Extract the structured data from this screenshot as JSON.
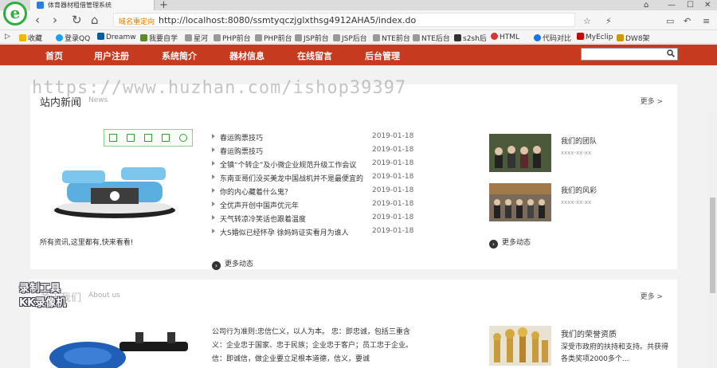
{
  "browser": {
    "tab_title": "体育器材租借管理系统",
    "address_tag": "域名重定向",
    "url": "http://localhost:8080/ssmtyqczjglxthsg4912AHA5/index.do",
    "bookmarks": [
      "收藏",
      "登录QQ",
      "Dreamw",
      "我要自学",
      "星河",
      "PHP前台",
      "PHP前台",
      "JSP前台",
      "JSP后台",
      "NTE前台",
      "NTE后台",
      "s2sh后",
      "HTML",
      "代码对比",
      "MyEclip",
      "DW8架"
    ]
  },
  "nav": {
    "items": [
      "首页",
      "用户注册",
      "系统简介",
      "器材信息",
      "在线留言",
      "后台管理"
    ],
    "search_placeholder": ""
  },
  "watermark": "https://www.huzhan.com/ishop39397",
  "news": {
    "title": "站内新闻",
    "subtitle": "News",
    "more": "更多 >",
    "caption": "所有资讯,这里都有,快来看看!",
    "items": [
      {
        "text": "春运购票技巧",
        "date": "2019-01-18"
      },
      {
        "text": "春运购票技巧",
        "date": "2019-01-18"
      },
      {
        "text": "全镇“个转企”及小微企业规范升级工作会议",
        "date": "2019-01-18"
      },
      {
        "text": "东南亚哥们没买美龙中国战机并不是最便宜的",
        "date": "2019-01-18"
      },
      {
        "text": "你的内心藏着什么鬼？",
        "date": "2019-01-18"
      },
      {
        "text": "全优声开创中国声优元年",
        "date": "2019-01-18"
      },
      {
        "text": "天气转凉冷笑话也跟着温度",
        "date": "2019-01-18"
      },
      {
        "text": "大S婚似已经怀孕 徐妈妈证实看月为谁人",
        "date": "2019-01-18"
      }
    ],
    "more_link": "更多动态",
    "side": [
      {
        "label": "我们的团队",
        "meta": "xxxx-xx-xx"
      },
      {
        "label": "我们的风彩",
        "meta": "xxxx-xx-xx"
      }
    ],
    "side_more": "更多动态"
  },
  "about": {
    "title": "关于我们",
    "subtitle": "About us",
    "more": "更多 >",
    "text": "公司行为准则:忠信仁义，以人为本。 忠：即忠诚，包括三重含义：企业忠于国家、忠于民族；企业忠于客户；员工忠于企业。 信：即诚信，做企业要立足根本道德，信义，要诚",
    "honor_title": "我们的荣誉资质",
    "honor_desc": "深受市政府的扶持和支持。共获得各类奖项2000多个..."
  },
  "recorder": [
    "录制工具",
    "KK录像机"
  ],
  "colors": {
    "nav_bg": "#c63a20",
    "browser_accent": "#2fae3b"
  }
}
